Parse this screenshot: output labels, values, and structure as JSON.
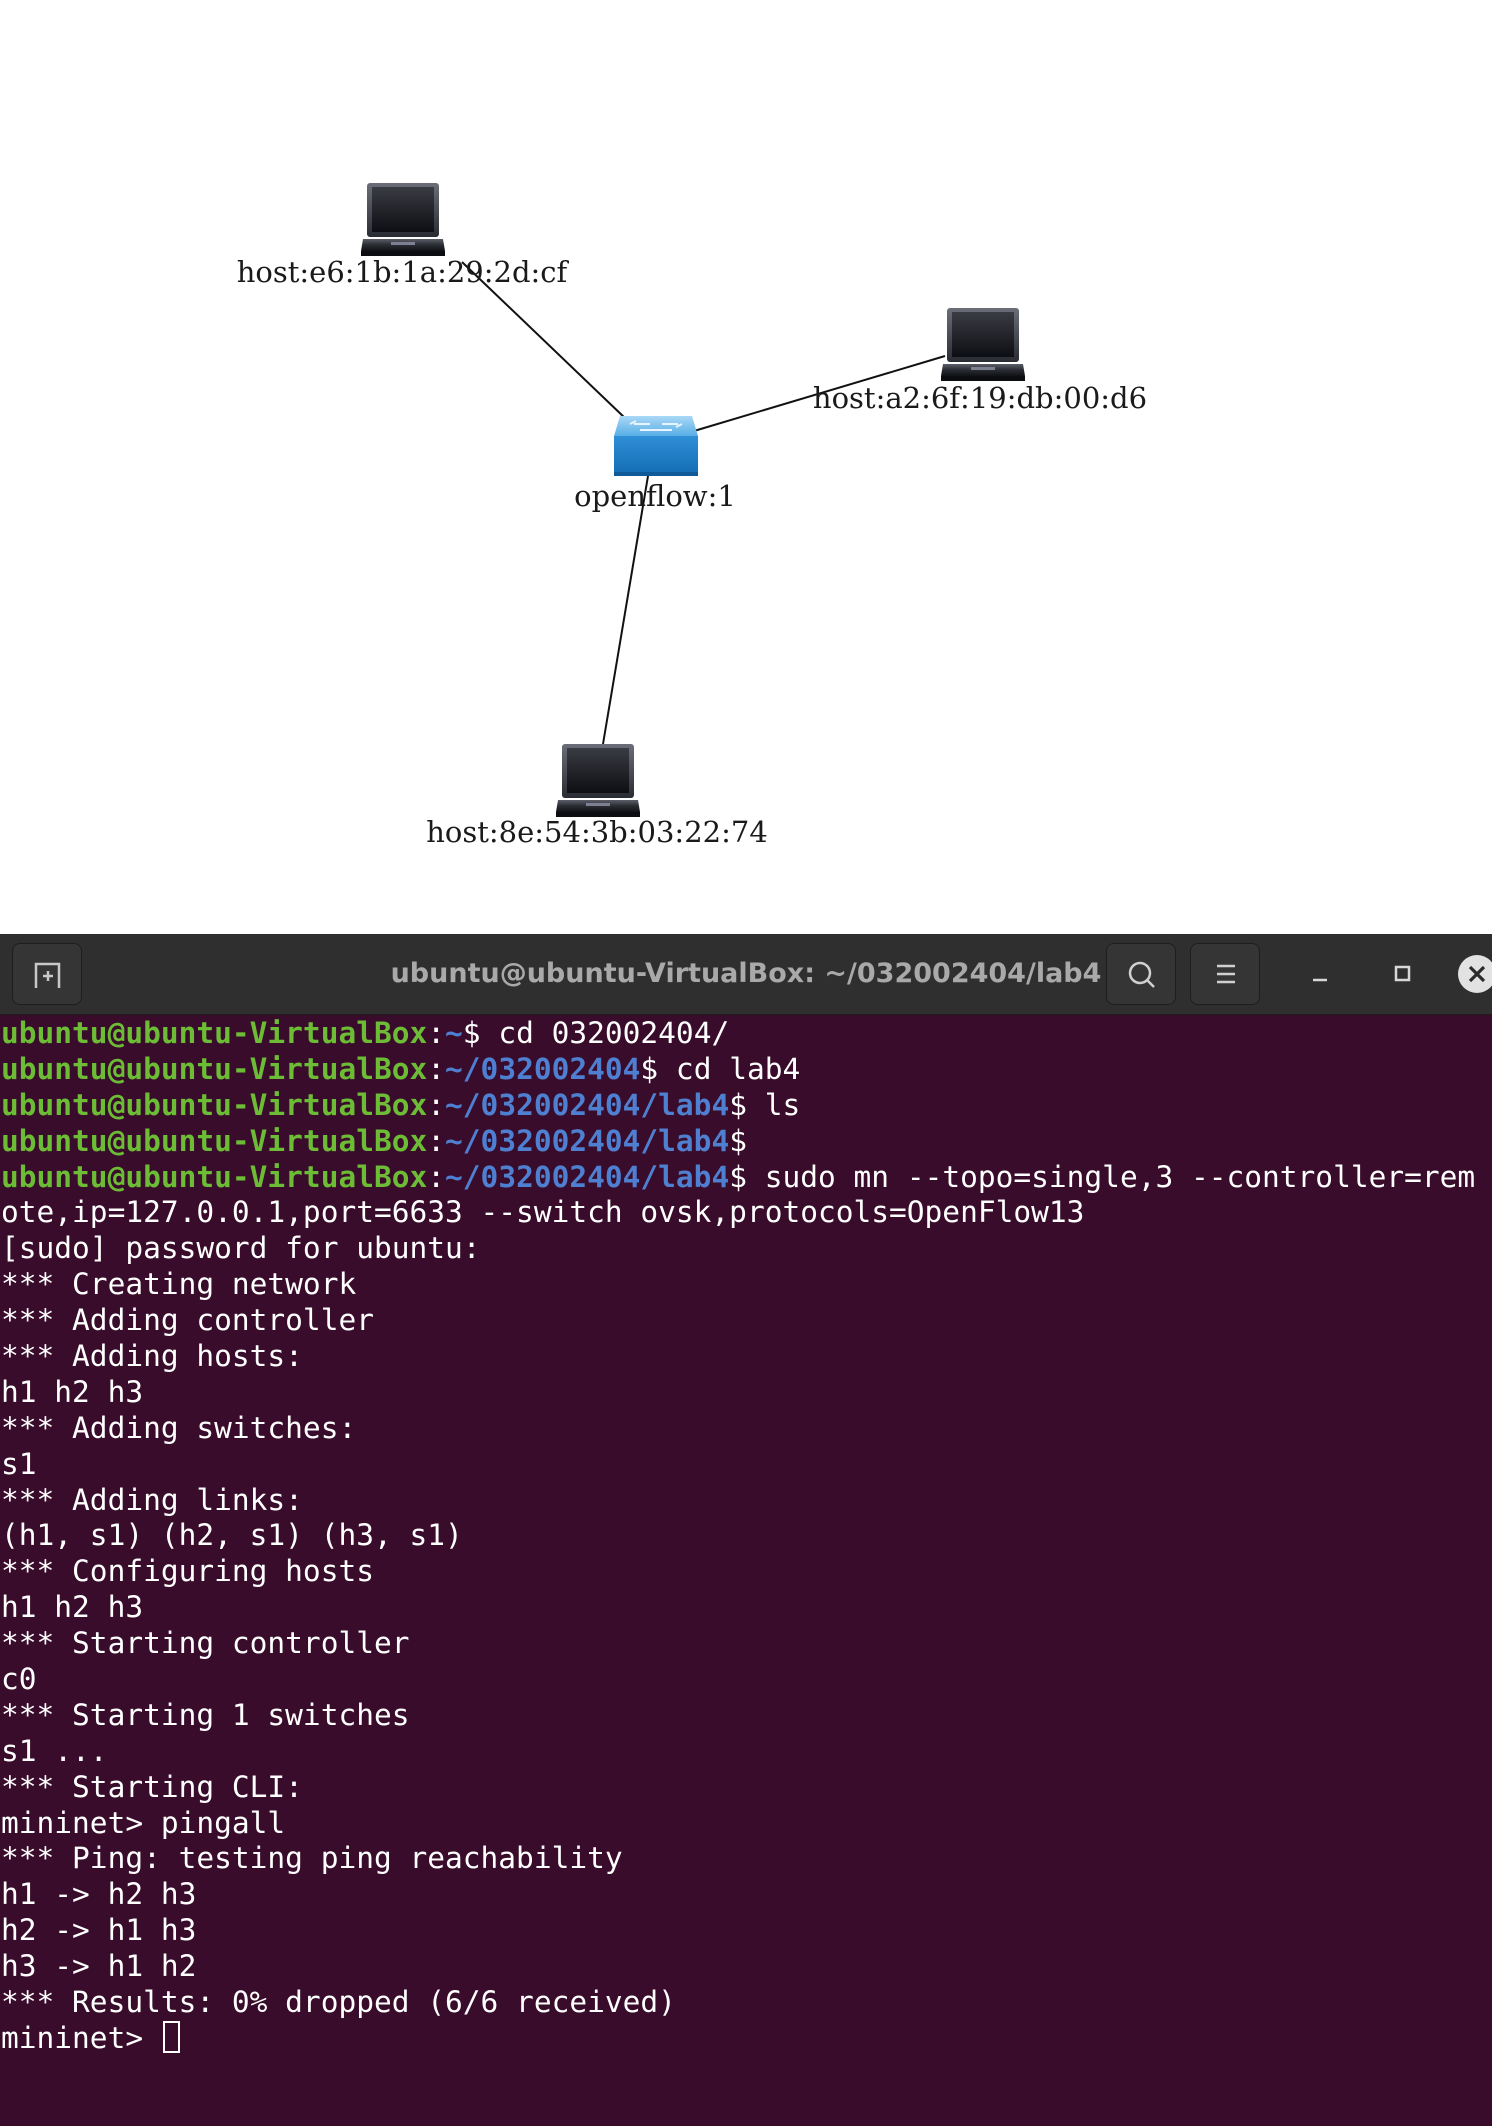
{
  "topology": {
    "switch": {
      "label": "openflow:1",
      "icon": "network-switch-icon"
    },
    "hosts": [
      {
        "label": "host:e6:1b:1a:29:2d:cf",
        "icon": "laptop-icon"
      },
      {
        "label": "host:a2:6f:19:db:00:d6",
        "icon": "laptop-icon"
      },
      {
        "label": "host:8e:54:3b:03:22:74",
        "icon": "laptop-icon"
      }
    ]
  },
  "terminal": {
    "title": "ubuntu@ubuntu-VirtualBox: ~/032002404/lab4",
    "icons": {
      "new_tab": "new-tab-icon",
      "search": "search-icon",
      "menu": "hamburger-menu-icon",
      "minimize": "minimize-icon",
      "maximize": "maximize-icon",
      "close": "close-icon"
    },
    "prompt_user": "ubuntu@ubuntu-VirtualBox",
    "colors": {
      "background": "#380c2a",
      "user": "#6cbc36",
      "path": "#4e7fd0",
      "text": "#ffffff",
      "titlebar": "#2f2f2f"
    },
    "lines": [
      {
        "type": "prompt",
        "path": "~",
        "cmd": " cd 032002404/"
      },
      {
        "type": "prompt",
        "path": "~/032002404",
        "cmd": " cd lab4"
      },
      {
        "type": "prompt",
        "path": "~/032002404/lab4",
        "cmd": " ls"
      },
      {
        "type": "prompt",
        "path": "~/032002404/lab4",
        "cmd": ""
      },
      {
        "type": "prompt",
        "path": "~/032002404/lab4",
        "cmd": " sudo mn --topo=single,3 --controller=rem"
      },
      {
        "type": "out",
        "text": "ote,ip=127.0.0.1,port=6633 --switch ovsk,protocols=OpenFlow13"
      },
      {
        "type": "out",
        "text": "[sudo] password for ubuntu:"
      },
      {
        "type": "out",
        "text": "*** Creating network"
      },
      {
        "type": "out",
        "text": "*** Adding controller"
      },
      {
        "type": "out",
        "text": "*** Adding hosts:"
      },
      {
        "type": "out",
        "text": "h1 h2 h3"
      },
      {
        "type": "out",
        "text": "*** Adding switches:"
      },
      {
        "type": "out",
        "text": "s1"
      },
      {
        "type": "out",
        "text": "*** Adding links:"
      },
      {
        "type": "out",
        "text": "(h1, s1) (h2, s1) (h3, s1)"
      },
      {
        "type": "out",
        "text": "*** Configuring hosts"
      },
      {
        "type": "out",
        "text": "h1 h2 h3"
      },
      {
        "type": "out",
        "text": "*** Starting controller"
      },
      {
        "type": "out",
        "text": "c0"
      },
      {
        "type": "out",
        "text": "*** Starting 1 switches"
      },
      {
        "type": "out",
        "text": "s1 ..."
      },
      {
        "type": "out",
        "text": "*** Starting CLI:"
      },
      {
        "type": "out",
        "text": "mininet> pingall"
      },
      {
        "type": "out",
        "text": "*** Ping: testing ping reachability"
      },
      {
        "type": "out",
        "text": "h1 -> h2 h3"
      },
      {
        "type": "out",
        "text": "h2 -> h1 h3"
      },
      {
        "type": "out",
        "text": "h3 -> h1 h2"
      },
      {
        "type": "out",
        "text": "*** Results: 0% dropped (6/6 received)"
      },
      {
        "type": "input",
        "text": "mininet> "
      }
    ]
  }
}
